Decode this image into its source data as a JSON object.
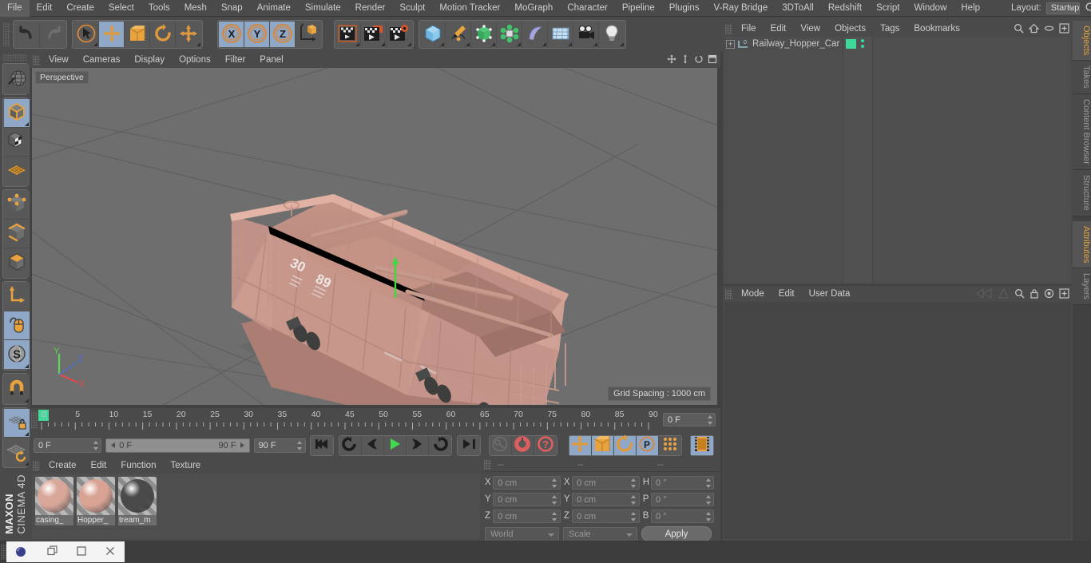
{
  "app": {
    "title": "CINEMA 4D",
    "brand_top": "MAXON",
    "brand_bottom": "CINEMA 4D"
  },
  "menubar": {
    "items": [
      {
        "label": "File"
      },
      {
        "label": "Edit"
      },
      {
        "label": "Create"
      },
      {
        "label": "Select"
      },
      {
        "label": "Tools"
      },
      {
        "label": "Mesh"
      },
      {
        "label": "Snap"
      },
      {
        "label": "Animate"
      },
      {
        "label": "Simulate"
      },
      {
        "label": "Render"
      },
      {
        "label": "Sculpt"
      },
      {
        "label": "Motion Tracker"
      },
      {
        "label": "MoGraph"
      },
      {
        "label": "Character"
      },
      {
        "label": "Pipeline"
      },
      {
        "label": "Plugins"
      },
      {
        "label": "V-Ray Bridge"
      },
      {
        "label": "3DToAll"
      },
      {
        "label": "Redshift"
      },
      {
        "label": "Script"
      },
      {
        "label": "Window"
      },
      {
        "label": "Help"
      }
    ],
    "layout_label": "Layout:",
    "layout_value": "Startup"
  },
  "toolbar": {
    "groups": [
      {
        "name": "history",
        "buttons": [
          {
            "name": "undo-button",
            "icon": "undo-icon",
            "selected": false
          },
          {
            "name": "redo-button",
            "icon": "redo-icon",
            "selected": false
          }
        ]
      },
      {
        "name": "transform-tools",
        "buttons": [
          {
            "name": "live-selection-tool",
            "icon": "cursor-circle-icon",
            "selected": false
          },
          {
            "name": "move-tool",
            "icon": "move-arrows-icon",
            "selected": true
          },
          {
            "name": "scale-tool",
            "icon": "scale-box-icon",
            "selected": false
          },
          {
            "name": "rotate-tool",
            "icon": "rotate-arc-icon",
            "selected": false
          },
          {
            "name": "general-move-tool",
            "icon": "move-arrows-icon",
            "selected": false
          }
        ]
      },
      {
        "name": "axis-locks",
        "buttons": [
          {
            "name": "lock-x-axis",
            "icon": "x-axis-icon",
            "selected": true,
            "letter": "X"
          },
          {
            "name": "lock-y-axis",
            "icon": "y-axis-icon",
            "selected": true,
            "letter": "Y"
          },
          {
            "name": "lock-z-axis",
            "icon": "z-axis-icon",
            "selected": true,
            "letter": "Z"
          },
          {
            "name": "world-object-coordinate-toggle",
            "icon": "world-axis-cube-icon",
            "selected": false
          }
        ]
      },
      {
        "name": "render-tools",
        "buttons": [
          {
            "name": "render-view-button",
            "icon": "render-clapper-icon",
            "selected": false
          },
          {
            "name": "render-to-picture-viewer-button",
            "icon": "render-picture-icon",
            "selected": false
          },
          {
            "name": "render-settings-button",
            "icon": "render-gear-icon",
            "selected": false
          }
        ]
      },
      {
        "name": "create-objects",
        "buttons": [
          {
            "name": "add-cube-button",
            "icon": "cube-icon",
            "selected": false
          },
          {
            "name": "add-spline-button",
            "icon": "pen-spline-icon",
            "selected": false
          },
          {
            "name": "add-generator-button",
            "icon": "nurbs-cube-icon",
            "selected": false
          },
          {
            "name": "add-deformer-button",
            "icon": "deformer-atom-icon",
            "selected": false
          },
          {
            "name": "add-environment-button",
            "icon": "sky-banana-icon",
            "selected": false
          },
          {
            "name": "add-scene-object-button",
            "icon": "floor-grid-icon",
            "selected": false
          },
          {
            "name": "add-camera-button",
            "icon": "camera-icon",
            "selected": false
          },
          {
            "name": "add-light-button",
            "icon": "lightbulb-icon",
            "selected": false
          }
        ]
      }
    ]
  },
  "left_toolbar": {
    "groups": [
      {
        "buttons": [
          {
            "name": "make-editable-button",
            "icon": "globe-editable-icon",
            "selected": false
          }
        ]
      },
      {
        "buttons": [
          {
            "name": "model-mode-button",
            "icon": "model-cube-icon",
            "selected": true
          },
          {
            "name": "texture-mode-button",
            "icon": "texture-checker-cube-icon",
            "selected": false
          },
          {
            "name": "workplane-mode-button",
            "icon": "workplane-grid-icon",
            "selected": false
          }
        ]
      },
      {
        "buttons": [
          {
            "name": "points-mode-button",
            "icon": "points-cube-icon",
            "selected": false
          },
          {
            "name": "edges-mode-button",
            "icon": "edges-cube-icon",
            "selected": false
          },
          {
            "name": "polygons-mode-button",
            "icon": "polygons-cube-icon",
            "selected": false
          }
        ]
      },
      {
        "buttons": [
          {
            "name": "enable-axis-modification-button",
            "icon": "axis-l-icon",
            "selected": false
          },
          {
            "name": "viewport-solo-button",
            "icon": "mouse-icon",
            "selected": true
          },
          {
            "name": "soft-selection-button",
            "icon": "s-sphere-icon",
            "selected": true
          }
        ]
      },
      {
        "buttons": [
          {
            "name": "snap-magnet-button",
            "icon": "magnet-icon",
            "selected": false
          }
        ]
      },
      {
        "buttons": [
          {
            "name": "lock-workplane-button",
            "icon": "workplane-lock-icon",
            "selected": true
          },
          {
            "name": "planar-workplane-button",
            "icon": "workplane-rotate-icon",
            "selected": false
          }
        ]
      }
    ]
  },
  "viewport": {
    "menu": [
      {
        "label": "View"
      },
      {
        "label": "Cameras"
      },
      {
        "label": "Display"
      },
      {
        "label": "Options"
      },
      {
        "label": "Filter"
      },
      {
        "label": "Panel"
      }
    ],
    "label": "Perspective",
    "grid_spacing": "Grid Spacing : 1000 cm",
    "axis_gizmo": {
      "x": "X",
      "y": "Y",
      "z": "Z",
      "x_color": "#e04b4b",
      "y_color": "#5ad84f",
      "z_color": "#4b6fe0"
    },
    "background_color": "#6e6e6e",
    "model": {
      "name": "Railway Hopper Car",
      "body_color": "#d4a295",
      "marking_left": "30",
      "marking_right": "89"
    }
  },
  "timeline": {
    "ticks": [
      {
        "label": "0",
        "value": 0
      },
      {
        "label": "5",
        "value": 5
      },
      {
        "label": "10",
        "value": 10
      },
      {
        "label": "15",
        "value": 15
      },
      {
        "label": "20",
        "value": 20
      },
      {
        "label": "25",
        "value": 25
      },
      {
        "label": "30",
        "value": 30
      },
      {
        "label": "35",
        "value": 35
      },
      {
        "label": "40",
        "value": 40
      },
      {
        "label": "45",
        "value": 45
      },
      {
        "label": "50",
        "value": 50
      },
      {
        "label": "55",
        "value": 55
      },
      {
        "label": "60",
        "value": 60
      },
      {
        "label": "65",
        "value": 65
      },
      {
        "label": "70",
        "value": 70
      },
      {
        "label": "75",
        "value": 75
      },
      {
        "label": "80",
        "value": 80
      },
      {
        "label": "85",
        "value": 85
      },
      {
        "label": "90",
        "value": 90
      }
    ],
    "range_min": 0,
    "range_max": 90,
    "current_frame_field": "0 F",
    "current_frame_left": "0 F",
    "range_start_field": "0 F",
    "range_end_field": "90 F",
    "end_frame_field": "90 F",
    "transport": [
      {
        "name": "go-to-start-button",
        "icon": "skip-start-icon"
      },
      {
        "name": "play-backwards-loop-button",
        "icon": "loop-back-icon"
      },
      {
        "name": "step-back-button",
        "icon": "step-back-icon"
      },
      {
        "name": "play-button",
        "icon": "play-icon"
      },
      {
        "name": "step-forward-button",
        "icon": "step-forward-icon"
      },
      {
        "name": "play-forward-loop-button",
        "icon": "loop-forward-icon"
      },
      {
        "name": "go-to-end-button",
        "icon": "skip-end-icon"
      }
    ],
    "record_tools": [
      {
        "name": "record-key-button",
        "icon": "key-icon",
        "selected": false
      },
      {
        "name": "autokeying-button",
        "icon": "autokey-red-icon",
        "selected": false
      },
      {
        "name": "keyframe-selection-button",
        "icon": "keyframe-question-icon",
        "selected": false
      }
    ],
    "key_toggles": [
      {
        "name": "record-position-button",
        "icon": "move-arrows-icon",
        "selected": true
      },
      {
        "name": "record-scale-button",
        "icon": "scale-box-icon",
        "selected": true
      },
      {
        "name": "record-rotation-button",
        "icon": "rotate-arc-icon",
        "selected": true
      },
      {
        "name": "record-pla-button",
        "icon": "p-circle-icon",
        "selected": true
      },
      {
        "name": "record-point-level-animation-button",
        "icon": "dots-grid-icon",
        "selected": false
      }
    ],
    "playback_mode": {
      "name": "animation-preview-button",
      "icon": "filmstrip-icon",
      "selected": true
    }
  },
  "material_manager": {
    "menu": [
      {
        "label": "Create"
      },
      {
        "label": "Edit"
      },
      {
        "label": "Function"
      },
      {
        "label": "Texture"
      }
    ],
    "materials": [
      {
        "name": "casing_",
        "color": "#d9a79a",
        "type": "diffuse"
      },
      {
        "name": "Hopper_",
        "color": "#d9a394",
        "type": "diffuse"
      },
      {
        "name": "tream_m",
        "color": "#4a4a4a",
        "type": "dark"
      }
    ]
  },
  "coordinates": {
    "header_dashes": [
      "--",
      "--",
      "--"
    ],
    "position": [
      {
        "label": "X",
        "value": "0 cm"
      },
      {
        "label": "Y",
        "value": "0 cm"
      },
      {
        "label": "Z",
        "value": "0 cm"
      }
    ],
    "size": [
      {
        "label": "X",
        "value": "0 cm"
      },
      {
        "label": "Y",
        "value": "0 cm"
      },
      {
        "label": "Z",
        "value": "0 cm"
      }
    ],
    "rotation": [
      {
        "label": "H",
        "value": "0 °"
      },
      {
        "label": "P",
        "value": "0 °"
      },
      {
        "label": "B",
        "value": "0 °"
      }
    ],
    "coord_system": "World",
    "size_mode": "Scale",
    "apply_label": "Apply"
  },
  "object_manager": {
    "menu": [
      {
        "label": "File"
      },
      {
        "label": "Edit"
      },
      {
        "label": "View"
      },
      {
        "label": "Objects"
      },
      {
        "label": "Tags"
      },
      {
        "label": "Bookmarks"
      }
    ],
    "icons": [
      {
        "name": "search-icon"
      },
      {
        "name": "home-icon"
      },
      {
        "name": "ellipse-icon"
      },
      {
        "name": "plus-box-icon"
      }
    ],
    "objects": [
      {
        "name": "Railway_Hopper_Car",
        "expandable": true,
        "tag_color": "#3fd89b",
        "type": "polygon-object"
      }
    ]
  },
  "attributes_panel": {
    "menu": [
      {
        "label": "Mode"
      },
      {
        "label": "Edit"
      },
      {
        "label": "User Data"
      }
    ],
    "icons": [
      {
        "name": "back-arrow-icon"
      },
      {
        "name": "forward-arrow-icon"
      },
      {
        "name": "pin-icon"
      },
      {
        "name": "search-icon"
      },
      {
        "name": "lock-icon"
      },
      {
        "name": "target-icon"
      },
      {
        "name": "plus-box-icon"
      }
    ]
  },
  "right_tabs": {
    "top": [
      {
        "label": "Objects",
        "active": true
      },
      {
        "label": "Takes",
        "active": false
      },
      {
        "label": "Content Browser",
        "active": false
      },
      {
        "label": "Structure",
        "active": false
      }
    ],
    "bottom": [
      {
        "label": "Attributes",
        "active": true
      },
      {
        "label": "Layers",
        "active": false
      }
    ]
  },
  "taskbar": {
    "window_icon": "cinema4d-icon",
    "buttons": [
      {
        "name": "restore-window-button",
        "icon": "restore-icon"
      },
      {
        "name": "maximize-window-button",
        "icon": "maximize-icon"
      },
      {
        "name": "close-window-button",
        "icon": "close-icon"
      }
    ]
  }
}
